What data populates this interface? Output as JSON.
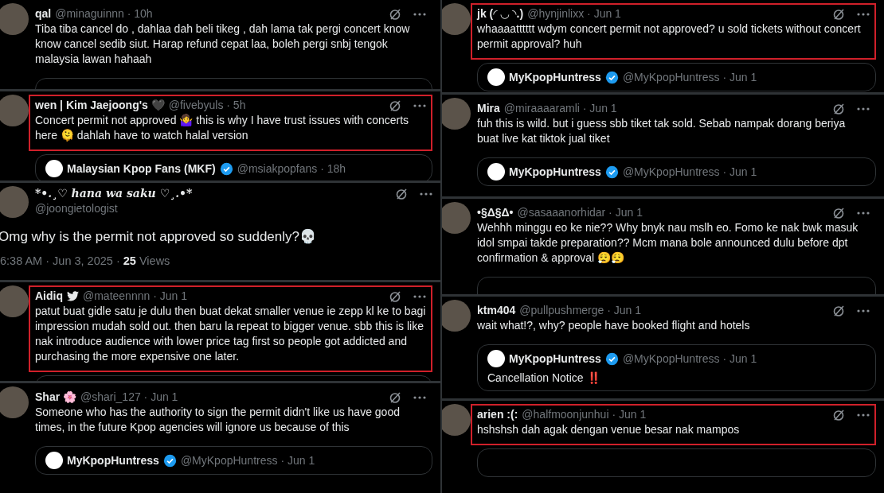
{
  "columns": [
    {
      "tweets": [
        {
          "kind": "reply",
          "name": "qal",
          "handle_time": "@minaguinnn · 10h",
          "text": "Tiba tiba cancel do , dahlaa dah beli tikeg , dah lama tak pergi concert know know cancel sedib siut. Harap refund cepat laa, boleh pergi snbj tengok malaysia lawan hahaah",
          "highlighted": false,
          "quote_stub": true
        },
        {
          "kind": "reply",
          "name": "wen | Kim Jaejoong's 🖤",
          "handle_time": "@fivebyuls · 5h",
          "text": "Concert permit not approved 🤷‍♀️ this is why I have trust issues with concerts here 🫠 dahlah have to watch halal version",
          "highlighted": true,
          "quote": {
            "name": "Malaysian Kpop Fans (MKF)",
            "verified": true,
            "handle_time": "@msiakpopfans · 18h"
          }
        },
        {
          "kind": "detail",
          "name": "*•.¸♡ hana wa saku ♡¸.•*",
          "handle": "@joongietologist",
          "text": "Omg why is the permit not approved so suddenly?💀",
          "meta": "6:38 AM · Jun 3, 2025 · **25** Views"
        },
        {
          "kind": "reply",
          "name": "Aidiq",
          "bird_badge": true,
          "handle_time": "@mateennnn · Jun 1",
          "text": "patut buat gidle satu je dulu then buat dekat smaller venue ie zepp kl ke to bagi impression mudah sold out. then baru la repeat to bigger venue. sbb this is like nak introduce audience with lower price tag first so people got addicted and purchasing the more expensive one later.",
          "highlighted": true,
          "quote_stub": true
        },
        {
          "kind": "reply",
          "name": "Shar 🌸",
          "handle_time": "@shari_127 · Jun 1",
          "text": "Someone who has the authority to sign the permit didn't like us have good times, in the future Kpop agencies will ignore us because of this",
          "highlighted": false,
          "quote": {
            "name": "MyKpopHuntress",
            "verified": true,
            "handle_time": "@MyKpopHuntress · Jun 1"
          }
        }
      ]
    },
    {
      "tweets": [
        {
          "kind": "reply",
          "name": "jk (◜ ◡ ◝.)",
          "handle_time": "@hynjinlixx · Jun 1",
          "text": "whaaaatttttt wdym concert permit not approved? u sold tickets without concert permit approval? huh",
          "highlighted": true,
          "quote": {
            "name": "MyKpopHuntress",
            "verified": true,
            "handle_time": "@MyKpopHuntress · Jun 1"
          }
        },
        {
          "kind": "reply",
          "name": "Mira",
          "handle_time": "@miraaaaramli · Jun 1",
          "text": "fuh this is wild. but i guess sbb tiket tak sold. Sebab nampak dorang beriya buat live kat tiktok jual tiket",
          "highlighted": false,
          "quote": {
            "name": "MyKpopHuntress",
            "verified": true,
            "handle_time": "@MyKpopHuntress · Jun 1"
          }
        },
        {
          "kind": "reply",
          "name": "•§Δ§Δ•",
          "handle_time": "@sasaaanorhidar · Jun 1",
          "text": "Wehhh minggu eo ke nie?? Why bnyk nau mslh eo. Fomo ke nak bwk masuk idol smpai takde preparation?? Mcm mana bole announced dulu before dpt confirmation & approval 😮‍💨😮‍💨",
          "highlighted": false,
          "quote_stub": true
        },
        {
          "kind": "reply",
          "name": "ktm404",
          "handle_time": "@pullpushmerge · Jun 1",
          "text": "wait what!?, why? people have booked flight and hotels",
          "highlighted": false,
          "quote": {
            "name": "MyKpopHuntress",
            "verified": true,
            "handle_time": "@MyKpopHuntress · Jun 1",
            "text": "Cancellation Notice ‼️"
          }
        },
        {
          "kind": "reply",
          "name": "arien :(:",
          "handle_time": "@halfmoonjunhui · Jun 1",
          "text": "hshshsh dah agak dengan venue besar nak mampos",
          "highlighted": true,
          "quote_stub": true
        }
      ]
    }
  ]
}
